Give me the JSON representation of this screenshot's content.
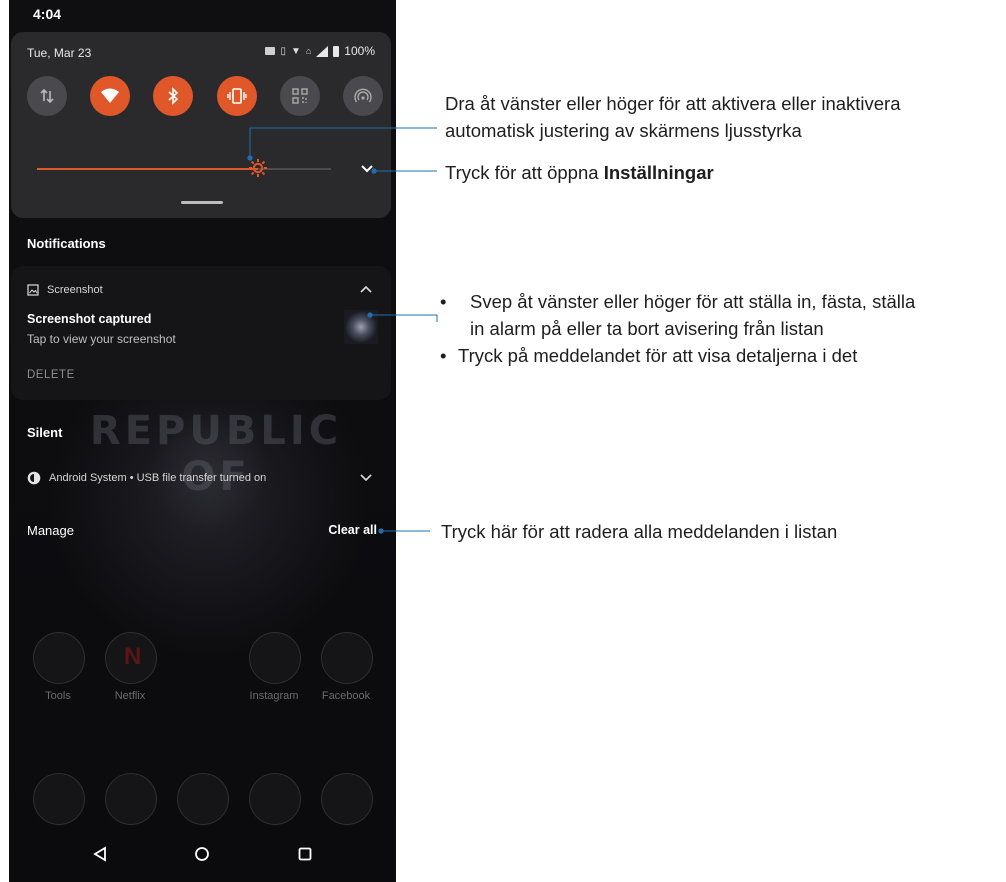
{
  "status_bar": {
    "time": "4:04"
  },
  "quick_settings": {
    "date": "Tue, Mar 23",
    "battery": "100%",
    "tiles": [
      {
        "name": "mobile-data",
        "on": false
      },
      {
        "name": "wifi",
        "on": true
      },
      {
        "name": "bluetooth",
        "on": true
      },
      {
        "name": "vibrate",
        "on": true
      },
      {
        "name": "qr-scan",
        "on": false
      },
      {
        "name": "hotspot",
        "on": false
      }
    ],
    "brightness_level": 0.75
  },
  "notifications": {
    "header": "Notifications",
    "card": {
      "app_name": "Screenshot",
      "title": "Screenshot captured",
      "body": "Tap to view your screenshot",
      "action": "DELETE"
    },
    "silent_header": "Silent",
    "silent_item": "Android System • USB file transfer turned on",
    "manage": "Manage",
    "clear_all": "Clear all"
  },
  "wallpaper_text": "REPUBLIC OF",
  "home_apps": [
    {
      "label": "Tools"
    },
    {
      "label": "Netflix"
    },
    {
      "label": "Instagram"
    },
    {
      "label": "Facebook"
    }
  ],
  "callouts": {
    "brightness_line1": "Dra åt vänster eller höger för att aktivera eller inaktivera",
    "brightness_line2": "automatisk justering av skärmens ljusstyrka",
    "settings_prefix": "Tryck för att öppna ",
    "settings_bold": "Inställningar",
    "swipe_bullet_line1": "Svep åt vänster eller höger för att ställa in, fästa, ställa",
    "swipe_bullet_line2": "in alarm på eller ta bort avisering från listan",
    "tap_bullet": "Tryck på meddelandet för att visa detaljerna i det",
    "clear_all_callout": "Tryck här för att radera alla meddelanden i listan"
  }
}
